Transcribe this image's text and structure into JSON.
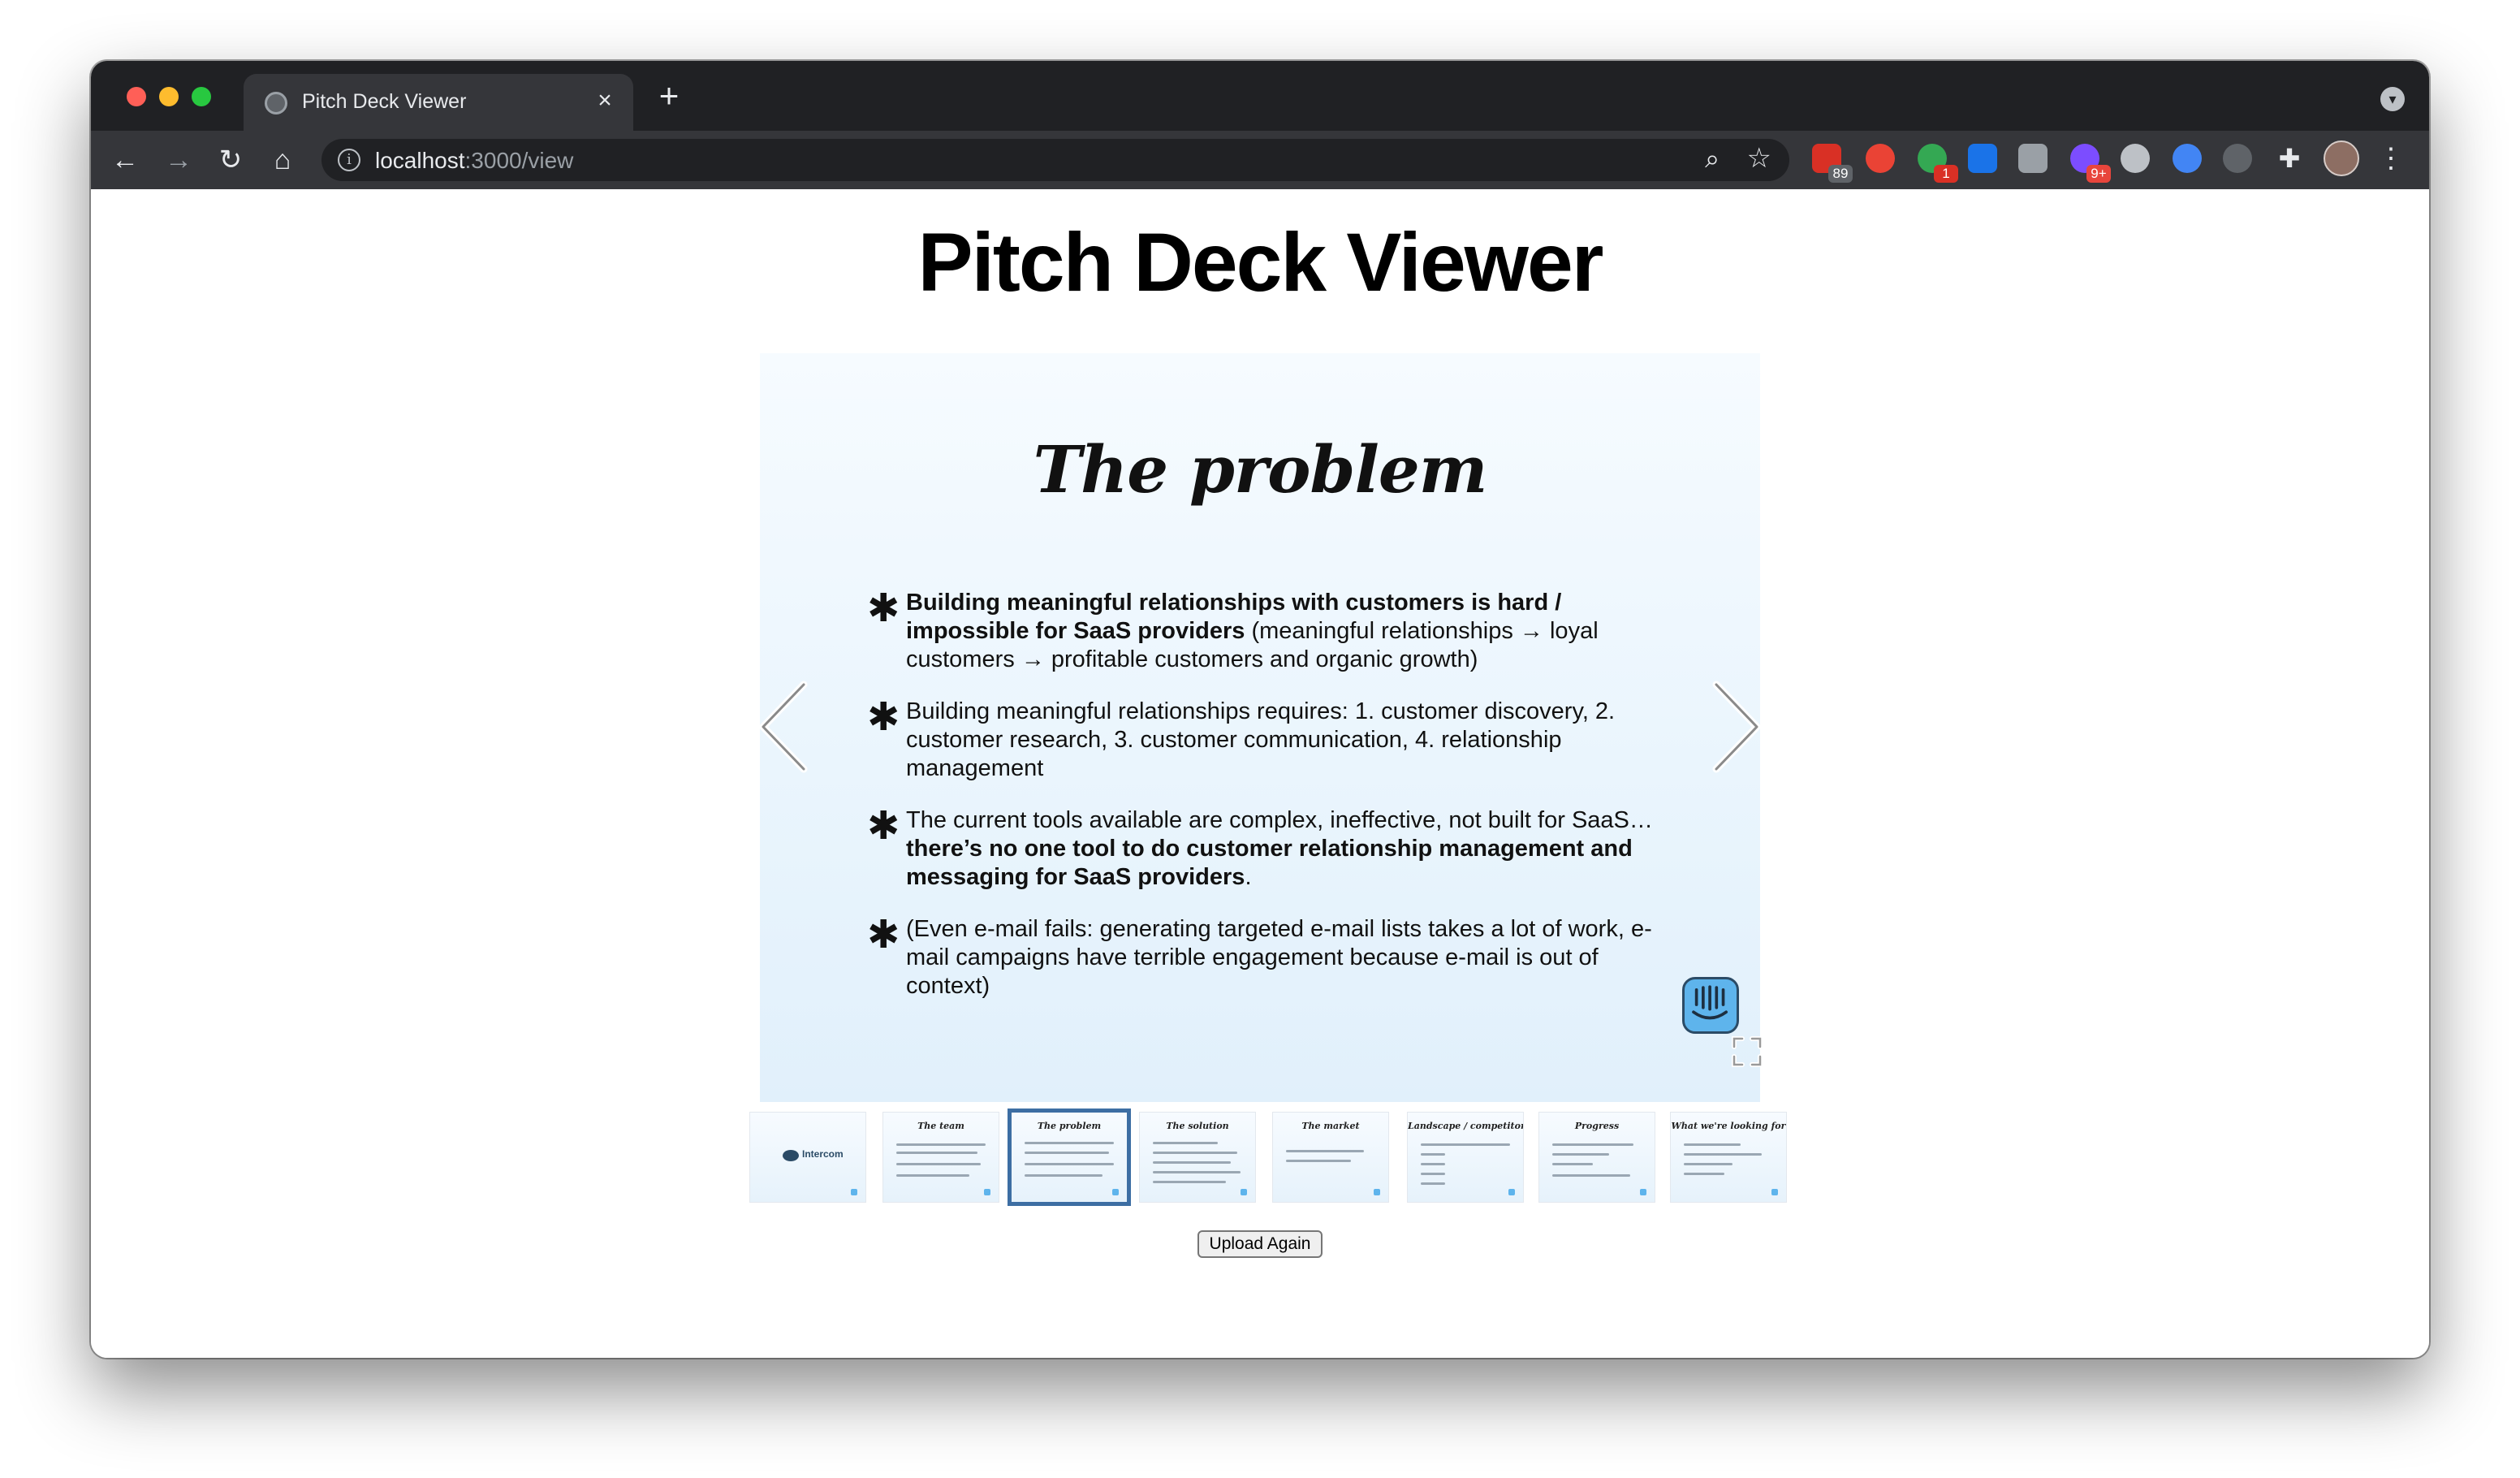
{
  "browser": {
    "tab_title": "Pitch Deck Viewer",
    "tab_close": "×",
    "new_tab": "+",
    "url_host": "localhost",
    "url_path": ":3000/view",
    "extensions": [
      {
        "name": "calendar-extension-icon",
        "badge": "89"
      },
      {
        "name": "stop-extension-icon",
        "badge": ""
      },
      {
        "name": "grammar-extension-icon",
        "badge": "1"
      },
      {
        "name": "trello-extension-icon",
        "badge": ""
      },
      {
        "name": "r-extension-icon",
        "badge": ""
      },
      {
        "name": "sparkle-extension-icon",
        "badge": "9+"
      }
    ]
  },
  "page": {
    "title": "Pitch Deck Viewer",
    "upload_again": "Upload Again"
  },
  "slide": {
    "title": "The problem",
    "bullets": [
      {
        "bold": "Building meaningful relationships with customers is hard / impossible for SaaS providers",
        "rest": " (meaningful relationships → loyal customers → profitable customers and organic growth)"
      },
      {
        "text": "Building meaningful relationships requires: 1. customer discovery, 2. customer research, 3. customer communication, 4. relationship management"
      },
      {
        "lead": "The current tools available are complex, ineffective, not built for SaaS… ",
        "bold": "there’s no one tool to do customer relationship management and messaging for SaaS providers",
        "tail": "."
      },
      {
        "text": "(Even e-mail fails: generating targeted e-mail lists takes a lot of work, e-mail campaigns have terrible engagement because e-mail is out of context)"
      }
    ]
  },
  "thumbnails": [
    {
      "label": "Intercom"
    },
    {
      "label": "The team"
    },
    {
      "label": "The problem"
    },
    {
      "label": "The solution"
    },
    {
      "label": "The market"
    },
    {
      "label": "Landscape / competitors"
    },
    {
      "label": "Progress"
    },
    {
      "label": "What we're looking for"
    }
  ],
  "active_thumbnail_index": 2
}
